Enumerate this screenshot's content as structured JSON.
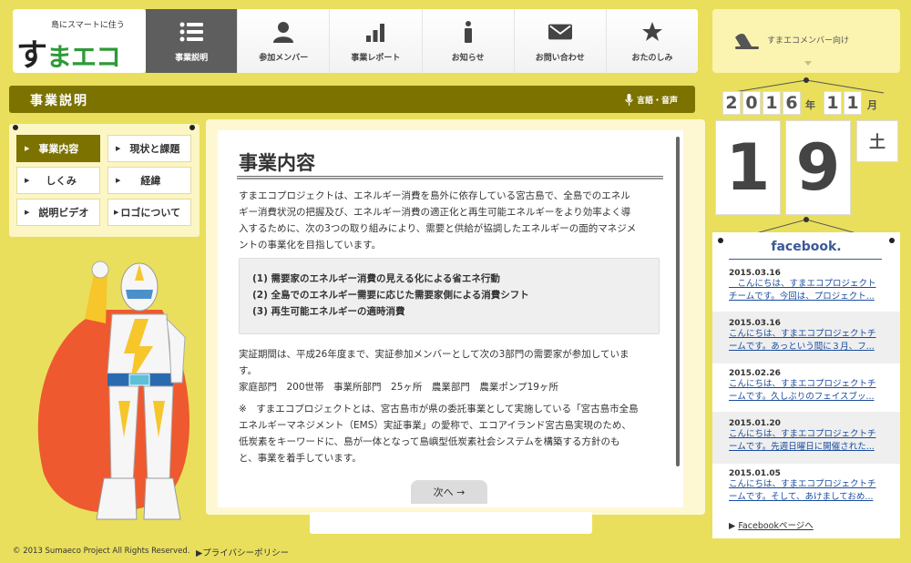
{
  "header": {
    "logo_tagline": "島にスマートに住う",
    "logo_text_su": "す",
    "logo_text_rest": "まエコ",
    "nav": [
      {
        "label": "事業説明",
        "icon": "list-icon",
        "active": true
      },
      {
        "label": "参加メンバー",
        "icon": "person-icon"
      },
      {
        "label": "事業レポート",
        "icon": "bar-chart-icon"
      },
      {
        "label": "お知らせ",
        "icon": "info-icon"
      },
      {
        "label": "お問い合わせ",
        "icon": "mail-icon"
      },
      {
        "label": "おたのしみ",
        "icon": "star-icon"
      }
    ],
    "member_link": "すまエコメンバー向け"
  },
  "title_bar": {
    "title": "事業説明",
    "speech": "言語・音声"
  },
  "submenu": [
    {
      "label": "事業内容",
      "active": true
    },
    {
      "label": "現状と課題"
    },
    {
      "label": "しくみ"
    },
    {
      "label": "経緯"
    },
    {
      "label": "説明ビデオ"
    },
    {
      "label": "ロゴについて"
    }
  ],
  "content": {
    "heading": "事業内容",
    "intro": [
      "すまエコプロジェクトは、エネルギー消費を島外に依存している宮古島で、全島でのエネル",
      "ギー消費状況の把握及び、エネルギー消費の適正化と再生可能エネルギーをより効率よく導",
      "入するために、次の3つの取り組みにより、需要と供給が協調したエネルギーの面的マネジメ",
      "ントの事業化を目指しています。"
    ],
    "list": [
      "(1) 需要家のエネルギー消費の見える化による省エネ行動",
      "(2) 全島でのエネルギー需要に応じた需要家側による消費シフト",
      "(3) 再生可能エネルギーの適時消費"
    ],
    "period": [
      "実証期間は、平成26年度まで、実証参加メンバーとして次の3部門の需要家が参加していま",
      "す。",
      "家庭部門　200世帯　事業所部門　25ヶ所　農業部門　農業ポンプ19ヶ所"
    ],
    "note": [
      "※　すまエコプロジェクトとは、宮古島市が県の委託事業として実施している「宮古島市全島",
      "エネルギーマネジメント（EMS）実証事業」の愛称で、エコアイランド宮古島実現のため、",
      "低炭素をキーワードに、島が一体となって島嶼型低炭素社会システムを構築する方針のも",
      "と、事業を着手しています。"
    ],
    "next_label": "次へ →"
  },
  "calendar": {
    "year_digits": [
      "2",
      "0",
      "1",
      "6"
    ],
    "year_unit": "年",
    "month_digits": [
      "1",
      "1"
    ],
    "month_unit": "月",
    "day_digits": [
      "1",
      "9"
    ],
    "weekday": "土"
  },
  "facebook": {
    "logo": "facebook.",
    "posts": [
      {
        "date": "2015.03.16",
        "line1": "　こんにちは、すまエコプロジェクト",
        "line2": "チームです。今回は、プロジェクト..."
      },
      {
        "date": "2015.03.16",
        "line1": "こんにちは、すまエコプロジェクトチ",
        "line2": "ームです。あっという間に３月、フ..."
      },
      {
        "date": "2015.02.26",
        "line1": "こんにちは、すまエコプロジェクトチ",
        "line2": "ームです。久しぶりのフェイスブッ..."
      },
      {
        "date": "2015.01.20",
        "line1": "こんにちは、すまエコプロジェクトチ",
        "line2": "ームです。先週日曜日に開催された..."
      },
      {
        "date": "2015.01.05",
        "line1": "こんにちは、すまエコプロジェクトチ",
        "line2": "ームです。そして、あけましておめ..."
      }
    ],
    "page_link": "Facebookページへ",
    "page_link_arrow": "▶"
  },
  "footer": {
    "copyright": "© 2013 Sumaeco Project All Rights Reserved.",
    "privacy": "▶プライバシーポリシー"
  },
  "colors": {
    "background": "#e9df5c",
    "olive": "#7c7200",
    "facebook": "#3b5998"
  }
}
